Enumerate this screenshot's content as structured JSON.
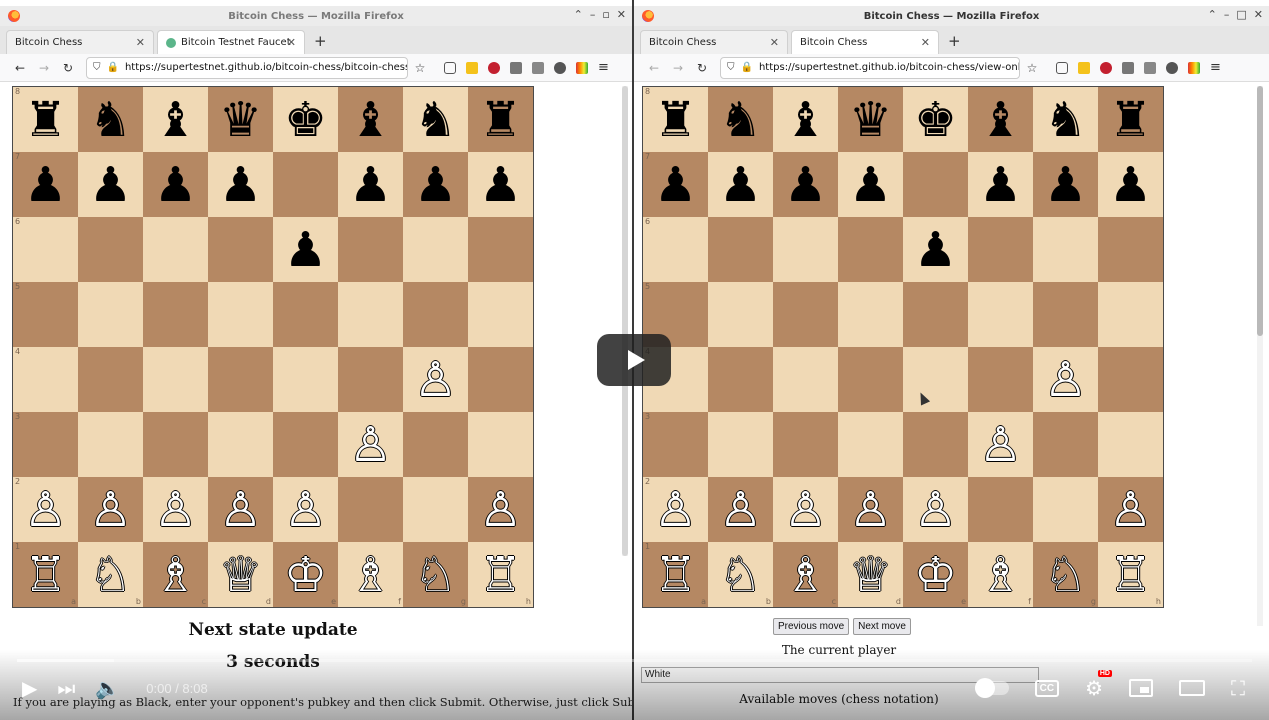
{
  "windows": {
    "left": {
      "title": "Bitcoin Chess — Mozilla Firefox",
      "tabs": [
        {
          "label": "Bitcoin Chess"
        },
        {
          "label": "Bitcoin Testnet Faucet"
        }
      ],
      "url": "https://supertestnet.github.io/bitcoin-chess/bitcoin-chess",
      "status_title": "Next state update",
      "countdown": "3 seconds",
      "instructions": "If you are playing as Black, enter your opponent's pubkey and then click Submit. Otherwise, just click Submit."
    },
    "right": {
      "title": "Bitcoin Chess — Mozilla Firefox",
      "tabs": [
        {
          "label": "Bitcoin Chess"
        },
        {
          "label": "Bitcoin Chess"
        }
      ],
      "url": "https://supertestnet.github.io/bitcoin-chess/view-only.html",
      "prev_move": "Previous move",
      "next_move": "Next move",
      "current_player_label": "The current player",
      "current_player_value": "White",
      "moves_label": "Available moves (chess notation)"
    }
  },
  "board": {
    "ranks": [
      "8",
      "7",
      "6",
      "5",
      "4",
      "3",
      "2",
      "1"
    ],
    "files": [
      "a",
      "b",
      "c",
      "d",
      "e",
      "f",
      "g",
      "h"
    ],
    "position": [
      [
        "♜",
        "♞",
        "♝",
        "♛",
        "♚",
        "♝",
        "♞",
        "♜"
      ],
      [
        "♟",
        "♟",
        "♟",
        "♟",
        "",
        "♟",
        "♟",
        "♟"
      ],
      [
        "",
        "",
        "",
        "",
        "♟",
        "",
        "",
        ""
      ],
      [
        "",
        "",
        "",
        "",
        "",
        "",
        "",
        ""
      ],
      [
        "",
        "",
        "",
        "",
        "",
        "",
        "♙",
        ""
      ],
      [
        "",
        "",
        "",
        "",
        "",
        "♙",
        "",
        ""
      ],
      [
        "♙",
        "♙",
        "♙",
        "♙",
        "♙",
        "",
        "",
        "♙"
      ],
      [
        "♖",
        "♘",
        "♗",
        "♕",
        "♔",
        "♗",
        "♘",
        "♖"
      ]
    ]
  },
  "player": {
    "time": "0:00 / 8:08",
    "hd_badge": "HD",
    "cc_label": "CC",
    "progress_buffered": 0.08
  },
  "colors": {
    "light_square": "#f0d9b5",
    "dark_square": "#b58863"
  },
  "icons": [
    "firefox-icon",
    "back-icon",
    "forward-icon",
    "reload-icon",
    "shield-icon",
    "lock-icon",
    "star-icon",
    "pocket-icon",
    "menu-icon",
    "play-icon",
    "next-icon",
    "volume-icon",
    "settings-icon",
    "miniplayer-icon",
    "theater-icon",
    "fullscreen-icon"
  ]
}
